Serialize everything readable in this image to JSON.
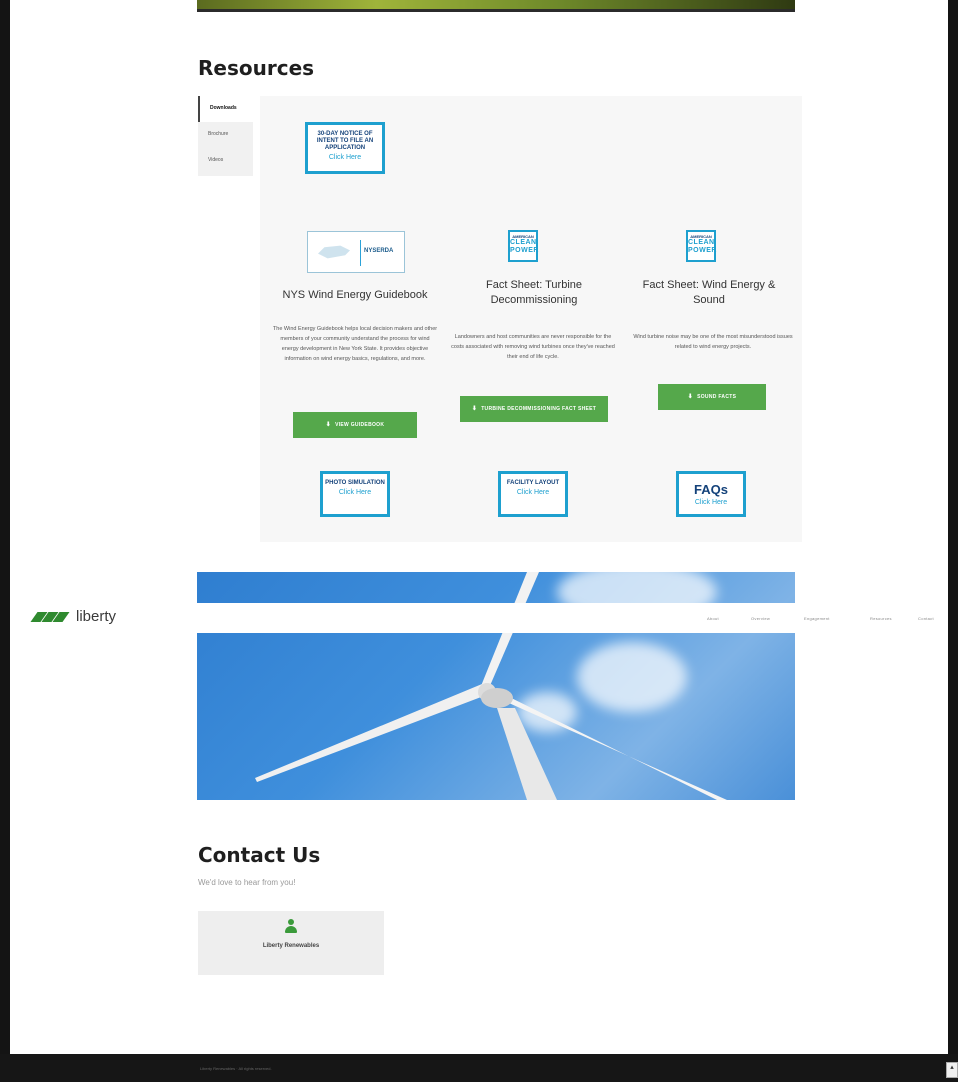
{
  "resources": {
    "title": "Resources",
    "tabs": [
      "Downloads",
      "Brochure",
      "Videos"
    ],
    "notice_badge": {
      "text": "30-DAY NOTICE OF INTENT TO FILE AN APPLICATION",
      "cta": "Click Here"
    },
    "cards": [
      {
        "logo": "NYSERDA",
        "title": "NYS Wind Energy Guidebook",
        "description": "The Wind Energy Guidebook helps local decision makers and other members of your community understand the process for wind energy development in New York State. It provides objective information on wind energy basics, regulations, and more.",
        "button": "VIEW GUIDEBOOK"
      },
      {
        "logo": [
          "AMERICAN",
          "CLEAN",
          "POWER"
        ],
        "title": "Fact Sheet: Turbine Decommissioning",
        "description": "Landowners and host communities are never responsible for the costs associated with removing wind turbines once they've reached their end of life cycle.",
        "button": "TURBINE DECOMMISSIONING FACT SHEET"
      },
      {
        "logo": [
          "AMERICAN",
          "CLEAN",
          "POWER"
        ],
        "title": "Fact Sheet: Wind Energy & Sound",
        "description": "Wind turbine noise may be one of the most misunderstood issues related to wind energy projects.",
        "button": "SOUND FACTS"
      }
    ],
    "bottom_badges": [
      {
        "text": "PHOTO SIMULATION",
        "cta": "Click Here"
      },
      {
        "text": "FACILITY LAYOUT",
        "cta": "Click Here"
      },
      {
        "text": "FAQs",
        "cta": "Click Here"
      }
    ]
  },
  "brand": {
    "logo_text": "liberty",
    "accent": "#55a84b",
    "badge_blue": "#1ea0cf"
  },
  "nav": [
    "About",
    "Overview",
    "Engagement",
    "Resources",
    "Contact"
  ],
  "contact": {
    "title": "Contact Us",
    "subtitle": "We'd love to hear from you!",
    "card_name": "Liberty Renewables"
  },
  "footer": {
    "copyright": "Liberty Renewables · All rights reserved."
  }
}
